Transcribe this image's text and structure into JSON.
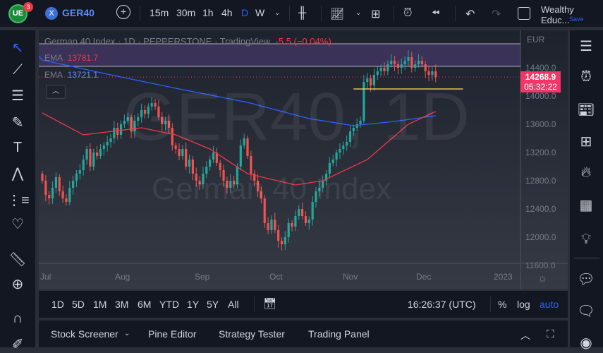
{
  "toolbar": {
    "badge": "3",
    "symbol": "GER40",
    "intervals": [
      "15m",
      "30m",
      "1h",
      "4h",
      "D",
      "W"
    ],
    "active_interval": "D",
    "account": "Wealthy Educ...",
    "save": "Save"
  },
  "legend": {
    "title": "German 40 Index · 1D · PEPPERSTONE · TradingView",
    "change": "-5.5 (−0.04%)",
    "ema1_label": "EMA",
    "ema1_value": "13781.7",
    "ema2_label": "EMA",
    "ema2_value": "13721.1"
  },
  "watermark": {
    "big": "GER40, 1D",
    "small": "German 40 Index"
  },
  "price_axis": {
    "currency": "EUR",
    "ticks": [
      "14400.0",
      "14000.0",
      "13600.0",
      "13200.0",
      "12800.0",
      "12400.0",
      "12000.0",
      "11600.0"
    ],
    "last_price": "14268.9",
    "countdown": "05:32:22"
  },
  "time_axis": {
    "ticks": [
      "Jul",
      "Aug",
      "Sep",
      "Oct",
      "Nov",
      "Dec",
      "2023"
    ]
  },
  "ranges": [
    "1D",
    "5D",
    "1M",
    "3M",
    "6M",
    "YTD",
    "1Y",
    "5Y",
    "All"
  ],
  "clock": "16:26:37 (UTC)",
  "scale": {
    "percent": "%",
    "log": "log",
    "auto": "auto"
  },
  "panel": {
    "tabs": [
      "Stock Screener",
      "Pine Editor",
      "Strategy Tester",
      "Trading Panel"
    ]
  },
  "colors": {
    "up": "#26a69a",
    "down": "#ef5350",
    "ema_red": "#f23645",
    "ema_blue": "#2962ff",
    "accent": "#2962ff",
    "price_tag": "#f23668",
    "hline": "#ffeb3b"
  },
  "chart_data": {
    "type": "candlestick",
    "ylim": [
      11600,
      14800
    ],
    "closes": [
      12800,
      12600,
      12550,
      12700,
      12850,
      12650,
      12550,
      12500,
      12700,
      12800,
      12900,
      12950,
      13100,
      13250,
      13000,
      13200,
      13150,
      13250,
      13300,
      13350,
      13400,
      13550,
      13450,
      13600,
      13650,
      13700,
      13500,
      13650,
      13700,
      13800,
      13750,
      13850,
      13900,
      13850,
      13700,
      13600,
      13650,
      13550,
      13300,
      13250,
      13150,
      13250,
      13000,
      13100,
      12900,
      12800,
      12750,
      12900,
      13000,
      13100,
      13200,
      13050,
      12950,
      12800,
      12700,
      12800,
      12750,
      13000,
      13300,
      13400,
      13150,
      12900,
      12800,
      12650,
      12550,
      12200,
      12100,
      12250,
      12100,
      11950,
      11900,
      12000,
      12200,
      12150,
      12300,
      12400,
      12300,
      12200,
      12250,
      12500,
      12650,
      12700,
      12800,
      12900,
      13050,
      13100,
      13200,
      13250,
      13300,
      13350,
      13500,
      13550,
      13600,
      13650,
      14200,
      14250,
      14150,
      14300,
      14350,
      14400,
      14350,
      14450,
      14500,
      14450,
      14400,
      14450,
      14500,
      14550,
      14400,
      14450,
      14500,
      14450,
      14350,
      14300,
      14350,
      14268.9
    ],
    "ema_red": [
      [
        0,
        13760
      ],
      [
        12,
        13450
      ],
      [
        29,
        13550
      ],
      [
        39,
        13450
      ],
      [
        49,
        13250
      ],
      [
        60,
        12900
      ],
      [
        74,
        12740
      ],
      [
        82,
        12800
      ],
      [
        95,
        13100
      ],
      [
        107,
        13600
      ],
      [
        115,
        13781.7
      ]
    ],
    "ema_blue": [
      [
        0,
        14510
      ],
      [
        19,
        14310
      ],
      [
        39,
        14110
      ],
      [
        60,
        13910
      ],
      [
        78,
        13680
      ],
      [
        91,
        13580
      ],
      [
        103,
        13640
      ],
      [
        115,
        13721.1
      ]
    ],
    "hline": 14100,
    "zone": [
      14420,
      14740
    ]
  }
}
